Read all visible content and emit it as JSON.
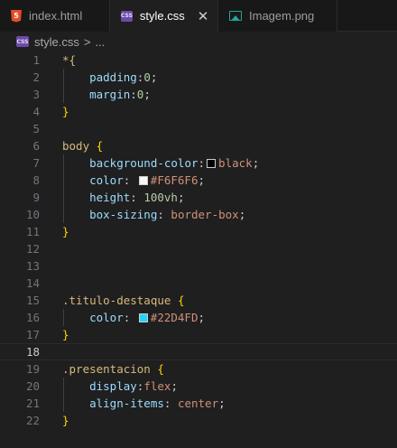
{
  "tabs": [
    {
      "label": "index.html",
      "icon": "html5-icon",
      "active": false
    },
    {
      "label": "style.css",
      "icon": "css-file-icon",
      "active": true,
      "close": "✕"
    },
    {
      "label": "Imagem.png",
      "icon": "image-file-icon",
      "active": false
    }
  ],
  "breadcrumb": {
    "file": "style.css",
    "separator": ">",
    "ellipsis": "..."
  },
  "lines": [
    {
      "n": "1",
      "tokens": [
        {
          "t": "*{",
          "c": "sel"
        }
      ]
    },
    {
      "n": "2",
      "tokens": [
        {
          "t": "    padding",
          "c": "prop"
        },
        {
          "t": ":",
          "c": "plain"
        },
        {
          "t": "0",
          "c": "num"
        },
        {
          "t": ";",
          "c": "plain"
        }
      ]
    },
    {
      "n": "3",
      "tokens": [
        {
          "t": "    margin",
          "c": "prop"
        },
        {
          "t": ":",
          "c": "plain"
        },
        {
          "t": "0",
          "c": "num"
        },
        {
          "t": ";",
          "c": "plain"
        }
      ]
    },
    {
      "n": "4",
      "tokens": [
        {
          "t": "}",
          "c": "brace"
        }
      ]
    },
    {
      "n": "5",
      "tokens": []
    },
    {
      "n": "6",
      "tokens": [
        {
          "t": "body ",
          "c": "sel"
        },
        {
          "t": "{",
          "c": "brace"
        }
      ]
    },
    {
      "n": "7",
      "tokens": [
        {
          "t": "    background-color",
          "c": "prop"
        },
        {
          "t": ":",
          "c": "plain"
        },
        {
          "swatch": "#000000"
        },
        {
          "t": "black",
          "c": "val"
        },
        {
          "t": ";",
          "c": "plain"
        }
      ]
    },
    {
      "n": "8",
      "tokens": [
        {
          "t": "    color",
          "c": "prop"
        },
        {
          "t": ": ",
          "c": "plain"
        },
        {
          "swatch": "#F6F6F6"
        },
        {
          "t": "#F6F6F6",
          "c": "val"
        },
        {
          "t": ";",
          "c": "plain"
        }
      ]
    },
    {
      "n": "9",
      "tokens": [
        {
          "t": "    height",
          "c": "prop"
        },
        {
          "t": ": ",
          "c": "plain"
        },
        {
          "t": "100vh",
          "c": "num"
        },
        {
          "t": ";",
          "c": "plain"
        }
      ]
    },
    {
      "n": "10",
      "tokens": [
        {
          "t": "    box-sizing",
          "c": "prop"
        },
        {
          "t": ": ",
          "c": "plain"
        },
        {
          "t": "border-box",
          "c": "val"
        },
        {
          "t": ";",
          "c": "plain"
        }
      ]
    },
    {
      "n": "11",
      "tokens": [
        {
          "t": "}",
          "c": "brace"
        }
      ]
    },
    {
      "n": "12",
      "tokens": []
    },
    {
      "n": "13",
      "tokens": []
    },
    {
      "n": "14",
      "tokens": []
    },
    {
      "n": "15",
      "tokens": [
        {
          "t": ".titulo-destaque ",
          "c": "sel"
        },
        {
          "t": "{",
          "c": "brace"
        }
      ]
    },
    {
      "n": "16",
      "tokens": [
        {
          "t": "    color",
          "c": "prop"
        },
        {
          "t": ": ",
          "c": "plain"
        },
        {
          "swatch": "#22D4FD"
        },
        {
          "t": "#22D4FD",
          "c": "val"
        },
        {
          "t": ";",
          "c": "plain"
        }
      ]
    },
    {
      "n": "17",
      "tokens": [
        {
          "t": "}",
          "c": "brace"
        }
      ]
    },
    {
      "n": "18",
      "tokens": [],
      "current": true
    },
    {
      "n": "19",
      "tokens": [
        {
          "t": ".presentacion ",
          "c": "sel"
        },
        {
          "t": "{",
          "c": "brace"
        }
      ]
    },
    {
      "n": "20",
      "tokens": [
        {
          "t": "    display",
          "c": "prop"
        },
        {
          "t": ":",
          "c": "plain"
        },
        {
          "t": "flex",
          "c": "val"
        },
        {
          "t": ";",
          "c": "plain"
        }
      ]
    },
    {
      "n": "21",
      "tokens": [
        {
          "t": "    align-items",
          "c": "prop"
        },
        {
          "t": ": ",
          "c": "plain"
        },
        {
          "t": "center",
          "c": "val"
        },
        {
          "t": ";",
          "c": "plain"
        }
      ]
    },
    {
      "n": "22",
      "tokens": [
        {
          "t": "}",
          "c": "brace"
        }
      ]
    }
  ]
}
